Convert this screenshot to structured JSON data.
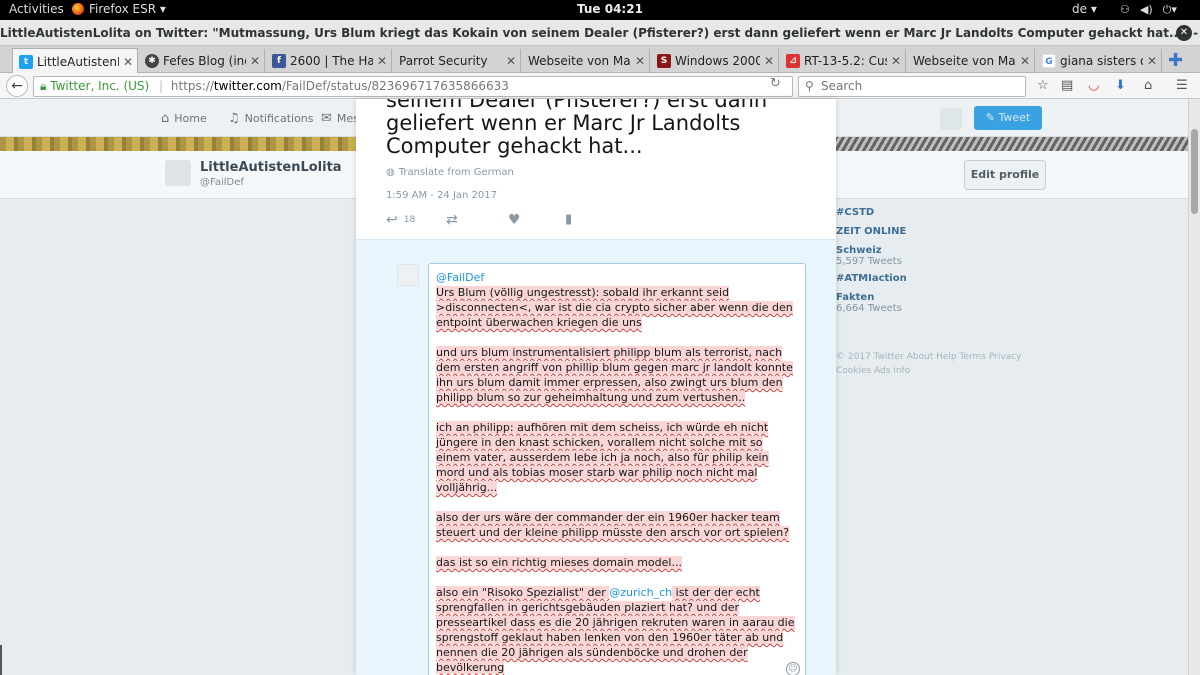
{
  "gnome": {
    "activities": "Activities",
    "app_name": "Firefox ESR ▾",
    "clock": "Tue 04:21",
    "language": "de ▾"
  },
  "window": {
    "title": "LittleAutistenLolita on Twitter: \"Mutmassung, Urs Blum kriegt das Kokain von seinem Dealer (Pfisterer?) erst dann geliefert wenn er Marc Jr Landolts Computer gehackt hat...\" - Mozilla Firefox"
  },
  "tabs": [
    {
      "label": "LittleAutistenLo...",
      "icon": "twitter-bird-icon",
      "color": "#1da1f2"
    },
    {
      "label": "Fefes Blog (ino...",
      "icon": "fefe-icon",
      "color": "#444444"
    },
    {
      "label": "2600 | The Hac...",
      "icon": "facebook-icon",
      "color": "#3b5998"
    },
    {
      "label": "Parrot Security",
      "icon": "",
      "color": ""
    },
    {
      "label": "Webseite von Marc...",
      "icon": "",
      "color": ""
    },
    {
      "label": "Windows 2000:...",
      "icon": "stanford-icon",
      "color": "#8c1515"
    },
    {
      "label": "RT-13-5.2: Cus...",
      "icon": "pdf-icon",
      "color": "#d33"
    },
    {
      "label": "Webseite von Marc...",
      "icon": "",
      "color": ""
    },
    {
      "label": "giana sisters o...",
      "icon": "google-icon",
      "color": "#4285f4"
    }
  ],
  "urlbar": {
    "identity": "Twitter, Inc. (US)",
    "protocol": "https://",
    "host": "twitter.com",
    "path": "/FailDef/status/823696717635866633"
  },
  "search": {
    "placeholder": "Search"
  },
  "twitter": {
    "nav": {
      "home": "Home",
      "notifications": "Notifications",
      "messages": "Mes"
    },
    "tweet_button": "Tweet",
    "profile": {
      "name": "LittleAutistenLolita",
      "handle": "@FailDef",
      "edit": "Edit profile"
    },
    "trends": [
      {
        "name": "#CSTD",
        "count": ""
      },
      {
        "name": "ZEIT ONLINE",
        "count": ""
      },
      {
        "name": "Schweiz",
        "count": "5,597 Tweets"
      },
      {
        "name": "#ATMIaction",
        "count": ""
      },
      {
        "name": "Fakten",
        "count": "6,664 Tweets"
      }
    ],
    "footer": "© 2017 Twitter  About  Help  Terms  Privacy  Cookies  Ads info"
  },
  "tweet": {
    "text": "seinem Dealer (Pfisterer?) erst dann geliefert wenn er Marc Jr Landolts Computer gehackt hat...",
    "translate": "Translate from German",
    "timestamp": "1:59 AM - 24 Jan 2017",
    "reply_count": "18"
  },
  "reply": {
    "mention": "@FailDef",
    "paragraphs": [
      "Urs Blum (völlig ungestresst): sobald ihr erkannt seid >disconnecten<, war ist die cia crypto sicher aber wenn die den entpoint überwachen kriegen die uns",
      "und urs blum instrumentalisiert philipp blum als terrorist, nach dem ersten angriff von phillip blum gegen marc jr landolt konnte ihn urs blum damit immer erpressen, also zwingt urs blum den philipp blum so zur geheimhaltung und zum vertushen..",
      "ich an philipp: aufhören mit dem scheiss, ich würde eh nicht jüngere in den knast schicken, vorallem nicht solche mit so einem vater, ausserdem lebe ich ja noch, also für philip kein mord und als tobias moser starb war philip noch nicht mal volljährig...",
      "also der urs wäre der commander der ein 1960er hacker team steuert und der kleine philipp müsste den arsch vor ort spielen?",
      "das ist so ein richtig mieses domain model..."
    ],
    "last_before": "also ein \"Risoko Spezialist\" der ",
    "last_mention": "@zurich_ch",
    "last_after": " ist der der echt sprengfallen in gerichtsgebäuden plaziert hat? und der presseartikel dass es die 20 jährigen rekruten waren in aarau die sprengstoff geklaut haben lenken von den 1960er täter ab und nennen die 20 jährigen als sündenböcke und drohen der bevölkerung"
  }
}
